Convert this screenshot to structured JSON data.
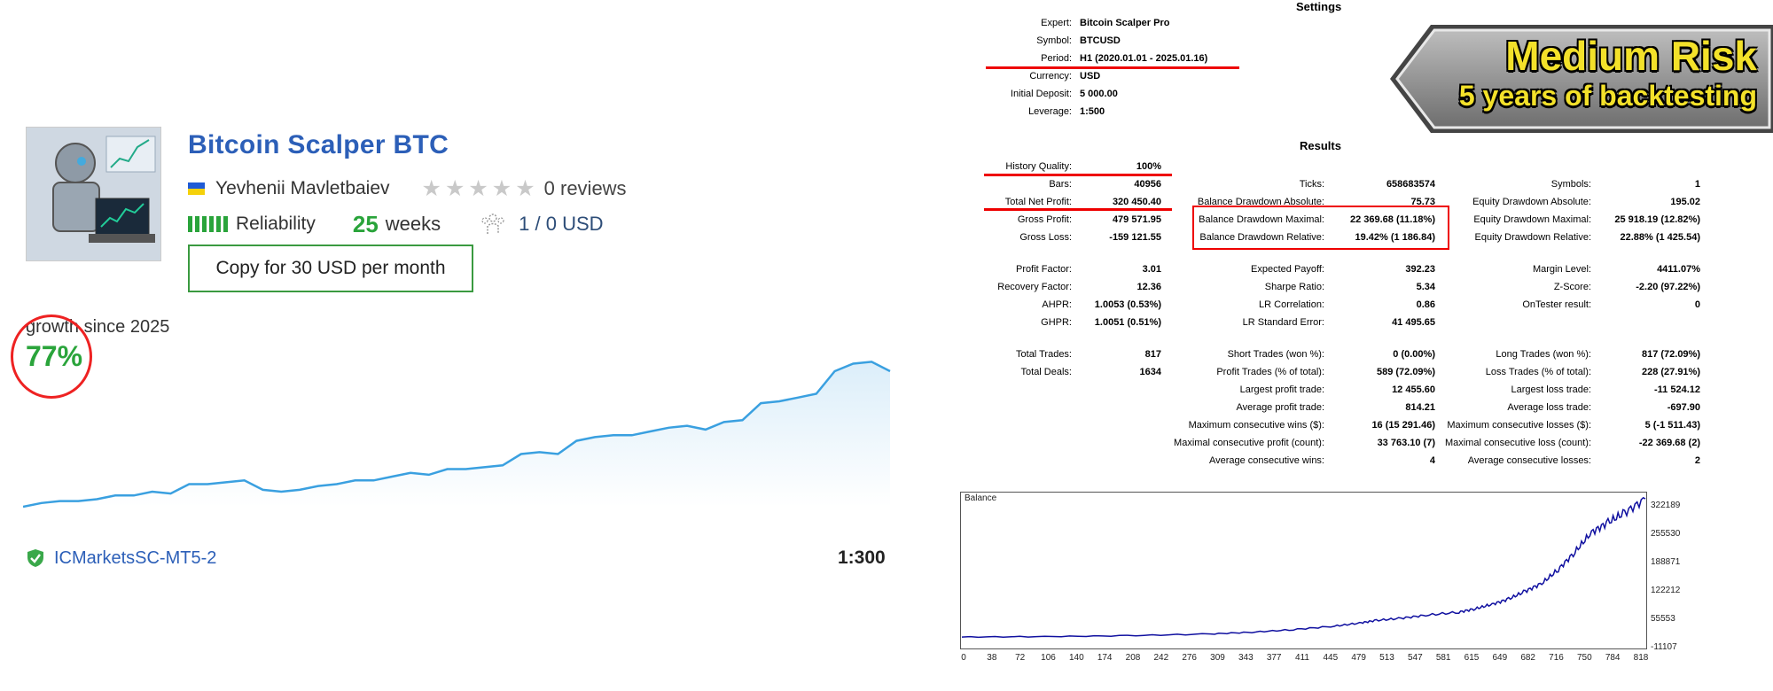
{
  "signal": {
    "title": "Bitcoin Scalper BTC",
    "author": "Yevhenii Mavletbaiev",
    "reviews": "0 reviews",
    "rating_stars": 0,
    "reliability_label": "Reliability",
    "weeks_value": "25",
    "weeks_label": "weeks",
    "subscribers": "1 / 0 USD",
    "copy_button": "Copy for 30 USD per month",
    "growth_label": "growth since 2025",
    "growth_value": "77%",
    "broker": "ICMarketsSC-MT5-2",
    "leverage": "1:300",
    "colors": {
      "title": "#2c5fb8",
      "green": "#2aa43b",
      "accent_red": "#e22222",
      "line": "#3aa0e0"
    },
    "growth_series": [
      0,
      2,
      3,
      3,
      4,
      6,
      6,
      8,
      7,
      12,
      12,
      13,
      14,
      9,
      8,
      9,
      11,
      12,
      14,
      14,
      16,
      18,
      17,
      20,
      20,
      21,
      22,
      28,
      29,
      28,
      35,
      37,
      38,
      38,
      40,
      42,
      43,
      41,
      45,
      46,
      55,
      56,
      58,
      60,
      72,
      76,
      77,
      72
    ]
  },
  "settings": {
    "title": "Settings",
    "rows": [
      {
        "label": "Expert:",
        "value": "Bitcoin Scalper Pro"
      },
      {
        "label": "Symbol:",
        "value": "BTCUSD"
      },
      {
        "label": "Period:",
        "value": "H1 (2020.01.01 - 2025.01.16)"
      },
      {
        "label": "Currency:",
        "value": "USD"
      },
      {
        "label": "Initial Deposit:",
        "value": "5 000.00"
      },
      {
        "label": "Leverage:",
        "value": "1:500"
      }
    ]
  },
  "results": {
    "title": "Results",
    "col1": [
      {
        "label": "History Quality:",
        "value": "100%"
      },
      {
        "label": "Bars:",
        "value": "40956"
      },
      {
        "label": "Total Net Profit:",
        "value": "320 450.40"
      },
      {
        "label": "Gross Profit:",
        "value": "479 571.95"
      },
      {
        "label": "Gross Loss:",
        "value": "-159 121.55"
      },
      {
        "label": "Profit Factor:",
        "value": "3.01"
      },
      {
        "label": "Recovery Factor:",
        "value": "12.36"
      },
      {
        "label": "AHPR:",
        "value": "1.0053 (0.53%)"
      },
      {
        "label": "GHPR:",
        "value": "1.0051 (0.51%)"
      },
      {
        "label": "Total Trades:",
        "value": "817"
      },
      {
        "label": "Total Deals:",
        "value": "1634"
      }
    ],
    "col2": [
      {
        "label": "Ticks:",
        "value": "658683574"
      },
      {
        "label": "Balance Drawdown Absolute:",
        "value": "75.73"
      },
      {
        "label": "Balance Drawdown Maximal:",
        "value": "22 369.68 (11.18%)"
      },
      {
        "label": "Balance Drawdown Relative:",
        "value": "19.42% (1 186.84)"
      },
      {
        "label": "Expected Payoff:",
        "value": "392.23"
      },
      {
        "label": "Sharpe Ratio:",
        "value": "5.34"
      },
      {
        "label": "LR Correlation:",
        "value": "0.86"
      },
      {
        "label": "LR Standard Error:",
        "value": "41 495.65"
      },
      {
        "label": "Short Trades (won %):",
        "value": "0 (0.00%)"
      },
      {
        "label": "Profit Trades (% of total):",
        "value": "589 (72.09%)"
      },
      {
        "label": "Largest profit trade:",
        "value": "12 455.60"
      },
      {
        "label": "Average profit trade:",
        "value": "814.21"
      },
      {
        "label": "Maximum consecutive wins ($):",
        "value": "16 (15 291.46)"
      },
      {
        "label": "Maximal consecutive profit (count):",
        "value": "33 763.10 (7)"
      },
      {
        "label": "Average consecutive wins:",
        "value": "4"
      }
    ],
    "col3": [
      {
        "label": "Symbols:",
        "value": "1"
      },
      {
        "label": "Equity Drawdown Absolute:",
        "value": "195.02"
      },
      {
        "label": "Equity Drawdown Maximal:",
        "value": "25 918.19 (12.82%)"
      },
      {
        "label": "Equity Drawdown Relative:",
        "value": "22.88% (1 425.54)"
      },
      {
        "label": "Margin Level:",
        "value": "4411.07%"
      },
      {
        "label": "Z-Score:",
        "value": "-2.20 (97.22%)"
      },
      {
        "label": "OnTester result:",
        "value": "0"
      },
      {
        "label": "Long Trades (won %):",
        "value": "817 (72.09%)"
      },
      {
        "label": "Loss Trades (% of total):",
        "value": "228 (27.91%)"
      },
      {
        "label": "Largest loss trade:",
        "value": "-11 524.12"
      },
      {
        "label": "Average loss trade:",
        "value": "-697.90"
      },
      {
        "label": "Maximum consecutive losses ($):",
        "value": "5 (-1 511.43)"
      },
      {
        "label": "Maximal consecutive loss (count):",
        "value": "-22 369.68 (2)"
      },
      {
        "label": "Average consecutive losses:",
        "value": "2"
      }
    ]
  },
  "badge": {
    "line1": "Medium Risk",
    "line2": "5 years of backtesting"
  },
  "chart_data": {
    "type": "line",
    "title": "Balance",
    "y_ticks": [
      "322189",
      "255530",
      "188871",
      "122212",
      "55553",
      "-11107"
    ],
    "x_ticks": [
      "0",
      "38",
      "72",
      "106",
      "140",
      "174",
      "208",
      "242",
      "276",
      "309",
      "343",
      "377",
      "411",
      "445",
      "479",
      "513",
      "547",
      "581",
      "615",
      "649",
      "682",
      "716",
      "750",
      "784",
      "818"
    ],
    "ylim": [
      -11107,
      322189
    ],
    "xlim": [
      0,
      825
    ],
    "series": [
      {
        "x": [
          0,
          100,
          200,
          300,
          350,
          400,
          450,
          480,
          500,
          530,
          560,
          600,
          620,
          640,
          660,
          680,
          700,
          720,
          740,
          760,
          780,
          800,
          825
        ],
        "y": [
          5000,
          6000,
          8000,
          12000,
          16000,
          22000,
          30000,
          37000,
          43000,
          48000,
          55000,
          62000,
          70000,
          80000,
          92000,
          110000,
          128000,
          160000,
          200000,
          245000,
          268000,
          290000,
          322000
        ]
      }
    ]
  }
}
